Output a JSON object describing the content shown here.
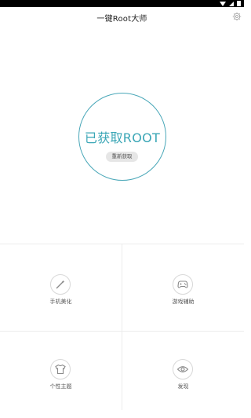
{
  "header": {
    "title": "一键Root大师"
  },
  "root": {
    "status": "已获取ROOT",
    "button_label": "重新获取"
  },
  "tiles": [
    {
      "label": "手机美化",
      "icon": "magic-wand-icon"
    },
    {
      "label": "游戏辅助",
      "icon": "gamepad-icon"
    },
    {
      "label": "个性主题",
      "icon": "tshirt-icon"
    },
    {
      "label": "发现",
      "icon": "eye-icon"
    }
  ],
  "colors": {
    "accent": "#3aa6b6",
    "ring": "#49a7b8",
    "button_bg": "#e6e6e6"
  }
}
